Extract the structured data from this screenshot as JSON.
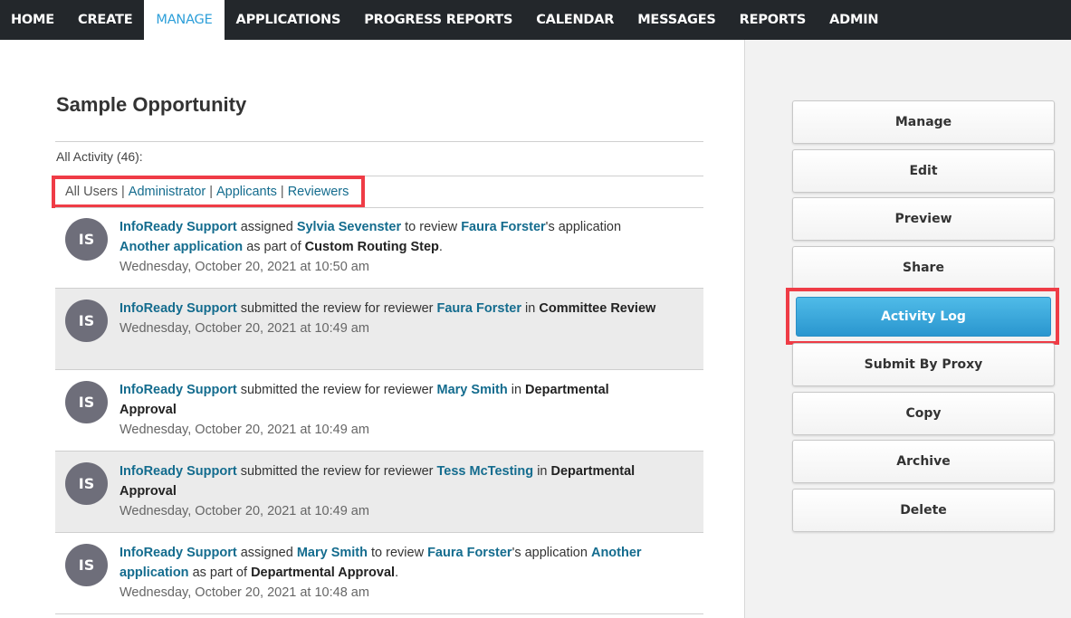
{
  "nav": {
    "items": [
      {
        "label": "HOME",
        "active": false
      },
      {
        "label": "CREATE",
        "active": false
      },
      {
        "label": "MANAGE",
        "active": true
      },
      {
        "label": "APPLICATIONS",
        "active": false
      },
      {
        "label": "PROGRESS REPORTS",
        "active": false
      },
      {
        "label": "CALENDAR",
        "active": false
      },
      {
        "label": "MESSAGES",
        "active": false
      },
      {
        "label": "REPORTS",
        "active": false
      },
      {
        "label": "ADMIN",
        "active": false
      }
    ]
  },
  "page": {
    "title": "Sample Opportunity",
    "activity_count": "All Activity (46):"
  },
  "filters": {
    "current": "All Users",
    "separator": "|",
    "administrator": "Administrator",
    "applicants": "Applicants",
    "reviewers": "Reviewers"
  },
  "activities": [
    {
      "initials": "IS",
      "actor": "InfoReady Support",
      "verb": "assigned",
      "target": "Sylvia Sevenster",
      "mid": "to review",
      "subject": "Faura Forster",
      "mid2": "'s application",
      "app": "Another application",
      "tail": "as part of",
      "step": "Custom Routing Step",
      "end": ".",
      "timestamp": "Wednesday, October 20, 2021 at 10:50 am"
    },
    {
      "initials": "IS",
      "actor": "InfoReady Support",
      "verb": "submitted the review for reviewer",
      "target": "Faura Forster",
      "mid": "in",
      "step": "Committee Review",
      "timestamp": "Wednesday, October 20, 2021 at 10:49 am"
    },
    {
      "initials": "IS",
      "actor": "InfoReady Support",
      "verb": "submitted the review for reviewer",
      "target": "Mary Smith",
      "mid": "in",
      "step": "Departmental Approval",
      "timestamp": "Wednesday, October 20, 2021 at 10:49 am"
    },
    {
      "initials": "IS",
      "actor": "InfoReady Support",
      "verb": "submitted the review for reviewer",
      "target": "Tess McTesting",
      "mid": "in",
      "step": "Departmental Approval",
      "timestamp": "Wednesday, October 20, 2021 at 10:49 am"
    },
    {
      "initials": "IS",
      "actor": "InfoReady Support",
      "verb": "assigned",
      "target": "Mary Smith",
      "mid": "to review",
      "subject": "Faura Forster",
      "mid2": "'s application",
      "app": "Another application",
      "tail": "as part of",
      "step": "Departmental Approval",
      "end": ".",
      "timestamp": "Wednesday, October 20, 2021 at 10:48 am"
    }
  ],
  "sidebar": {
    "manage": "Manage",
    "edit": "Edit",
    "preview": "Preview",
    "share": "Share",
    "activity_log": "Activity Log",
    "submit_by_proxy": "Submit By Proxy",
    "copy": "Copy",
    "archive": "Archive",
    "delete": "Delete"
  },
  "colors": {
    "nav_bg": "#23272b",
    "accent": "#2d9fd9",
    "link": "#146c8e",
    "highlight": "#ef3c46",
    "avatar": "#6e6e7a"
  }
}
